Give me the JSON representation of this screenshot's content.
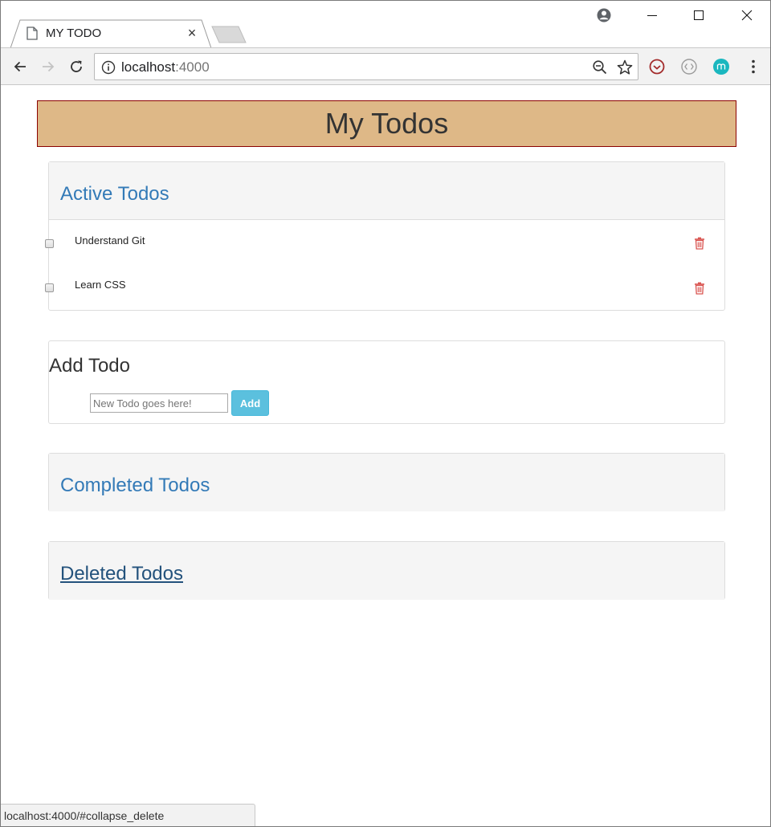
{
  "browser": {
    "tab_title": "MY TODO",
    "tab_close": "×",
    "url_host": "localhost",
    "url_port": ":4000",
    "status_url": "localhost:4000/#collapse_delete"
  },
  "page": {
    "header_title": "My Todos",
    "active": {
      "title": "Active Todos",
      "items": [
        {
          "label": "Understand Git"
        },
        {
          "label": "Learn CSS"
        }
      ]
    },
    "add": {
      "title": "Add Todo",
      "input_placeholder": "New Todo goes here!",
      "button_label": "Add"
    },
    "completed": {
      "title": "Completed Todos"
    },
    "deleted": {
      "title": "Deleted Todos"
    }
  },
  "colors": {
    "header_bg": "#deb887",
    "header_border": "#8b0000",
    "panel_title": "#337ab7",
    "add_button": "#5bc0de",
    "trash_icon": "#d9534f"
  }
}
